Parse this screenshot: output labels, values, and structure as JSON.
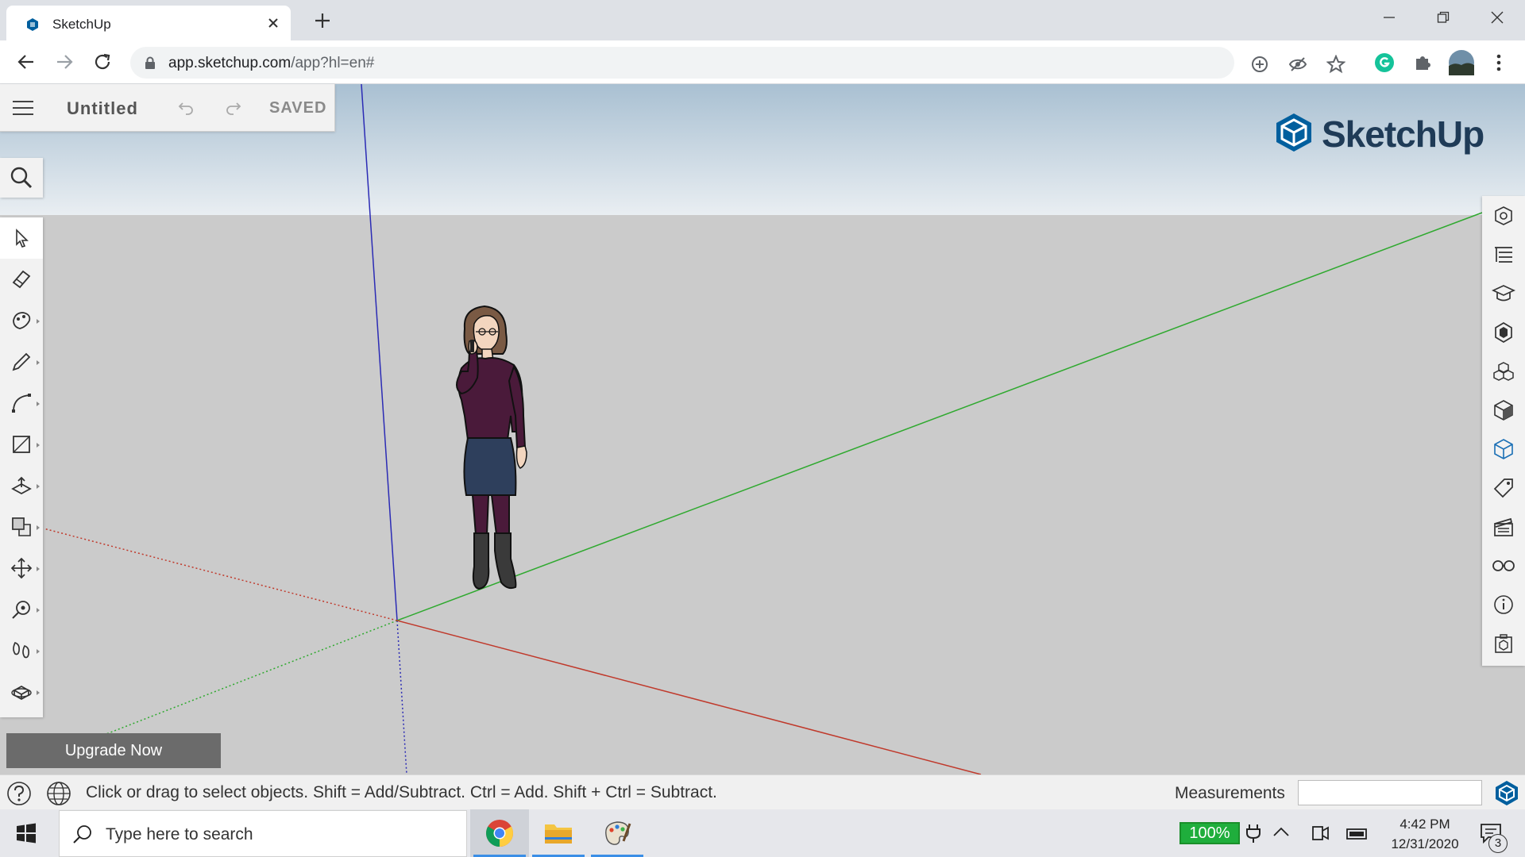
{
  "browser": {
    "tab_title": "SketchUp",
    "url_host": "app.sketchup.com",
    "url_path": "/app?hl=en#"
  },
  "app": {
    "document_title": "Untitled",
    "save_status": "SAVED",
    "brand": "SketchUp",
    "upgrade_label": "Upgrade Now",
    "left_tools": [
      "select-icon",
      "eraser-icon",
      "paint-bucket-icon",
      "pencil-icon",
      "arc-icon",
      "rectangle-icon",
      "push-pull-icon",
      "offset-icon",
      "move-icon",
      "tape-measure-icon",
      "walk-icon",
      "orbit-icon"
    ],
    "right_panels": [
      "entity-info-icon",
      "outliner-icon",
      "instructor-icon",
      "materials-icon",
      "components-icon",
      "styles-icon",
      "scenes-icon",
      "tags-icon",
      "display-icon",
      "glasses-icon",
      "info-icon",
      "solid-inspector-icon"
    ],
    "status_text": "Click or drag to select objects. Shift = Add/Subtract. Ctrl = Add. Shift + Ctrl = Subtract.",
    "measurements_label": "Measurements",
    "measurements_value": ""
  },
  "taskbar": {
    "search_placeholder": "Type here to search",
    "battery": "100%",
    "time": "4:42 PM",
    "date": "12/31/2020",
    "notifications": "3"
  },
  "colors": {
    "axis_red": "#c0392b",
    "axis_green": "#2fa92f",
    "axis_blue": "#2b2bb5",
    "brand_blue": "#005f9e"
  }
}
